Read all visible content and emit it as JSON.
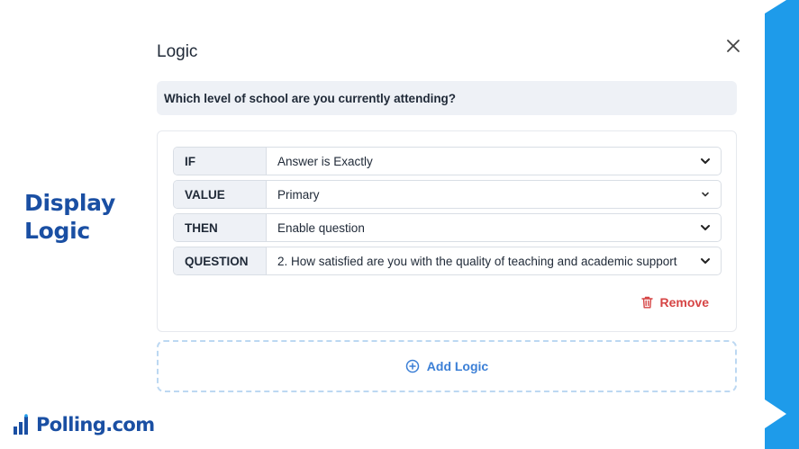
{
  "side_title": {
    "line1": "Display",
    "line2": "Logic"
  },
  "brand": {
    "name": "Polling.com",
    "icon": "bar-chart-logo-icon"
  },
  "dialog": {
    "title": "Logic",
    "close_icon": "close-icon",
    "question": "Which level of school are you currently attending?",
    "rows": [
      {
        "label": "IF",
        "value": "Answer is Exactly"
      },
      {
        "label": "VALUE",
        "value": "Primary"
      },
      {
        "label": "THEN",
        "value": "Enable question"
      },
      {
        "label": "QUESTION",
        "value": "2. How satisfied are you with the quality of teaching and academic support"
      }
    ],
    "remove_label": "Remove",
    "add_logic_label": "Add Logic"
  },
  "colors": {
    "brand_blue": "#1a4fa3",
    "accent_blue": "#3b7fd6",
    "ribbon_blue": "#1e9bea",
    "danger": "#d64545",
    "label_bg": "#eef1f6"
  }
}
